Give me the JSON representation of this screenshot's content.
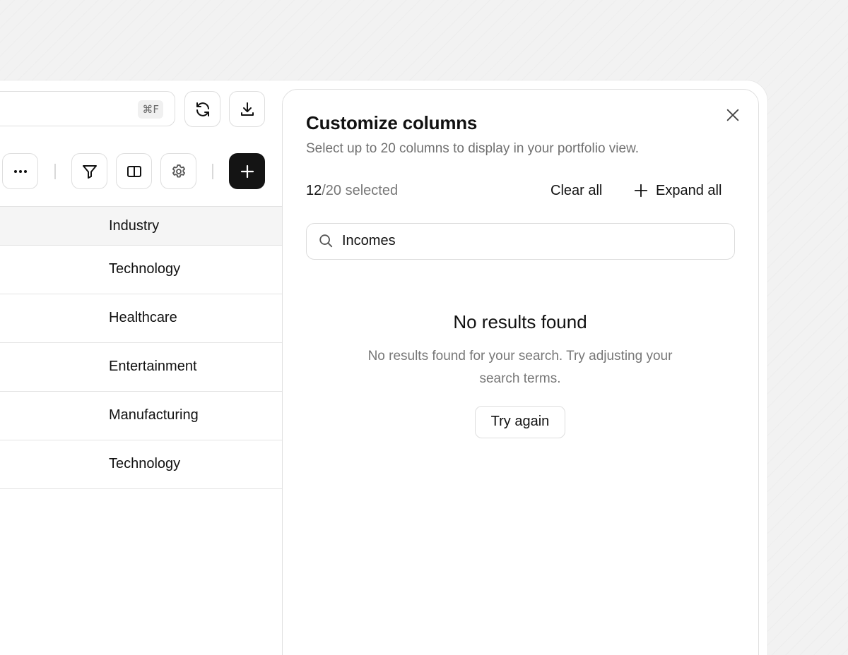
{
  "toolbar": {
    "search_shortcut": "⌘F",
    "icons": {
      "refresh": "refresh-icon",
      "download": "download-icon",
      "more": "more-horizontal-icon",
      "filter": "filter-icon",
      "columns": "columns-icon",
      "settings": "gear-icon",
      "add": "plus-icon"
    }
  },
  "table": {
    "header": "Industry",
    "rows": [
      "Technology",
      "Healthcare",
      "Entertainment",
      "Manufacturing",
      "Technology"
    ]
  },
  "panel": {
    "title": "Customize columns",
    "subtitle": "Select up to 20 columns to display in your portfolio view.",
    "selected_count": "12",
    "selected_total": "/20 selected",
    "clear_all_label": "Clear all",
    "expand_all_label": "Expand all",
    "search_value": "Incomes",
    "empty_title": "No results found",
    "empty_description": "No results found for your search. Try adjusting your search terms.",
    "try_again_label": "Try again"
  },
  "colors": {
    "primary_button": "#141414",
    "muted_text": "#777777",
    "border": "#dedede"
  }
}
